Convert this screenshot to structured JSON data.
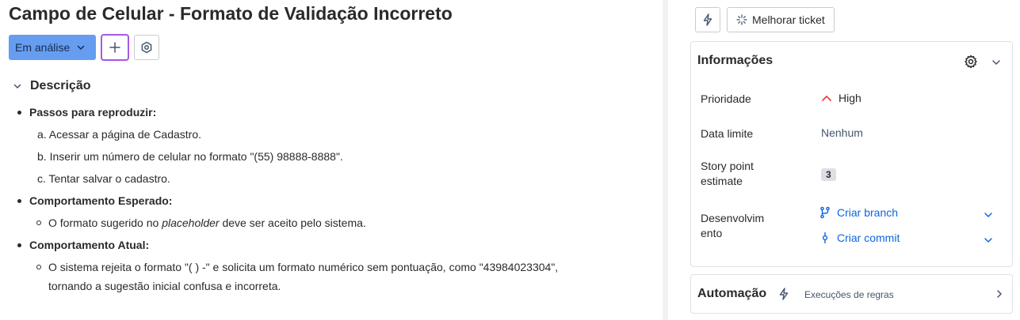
{
  "issue": {
    "title": "Campo de Celular - Formato de Validação Incorreto",
    "status_label": "Em análise"
  },
  "description": {
    "heading": "Descrição",
    "steps_heading": "Passos para reproduzir:",
    "steps": [
      "a. Acessar a página de Cadastro.",
      "b. Inserir um número de celular no formato \"(55) 98888-8888\".",
      "c. Tentar salvar o cadastro."
    ],
    "expected_heading": "Comportamento Esperado:",
    "expected_prefix": "O formato sugerido no ",
    "expected_italic": "placeholder",
    "expected_suffix": " deve ser aceito pelo sistema.",
    "actual_heading": "Comportamento Atual:",
    "actual_line1": "O sistema rejeita o formato \"( ) -\" e solicita um formato numérico sem pontuação, como \"43984023304\",",
    "actual_line2": "tornando a sugestão inicial confusa e incorreta."
  },
  "toolbar": {
    "improve_label": "Melhorar ticket"
  },
  "info": {
    "title": "Informações",
    "priority_label": "Prioridade",
    "priority_value": "High",
    "due_label": "Data limite",
    "due_value": "Nenhum",
    "story_label_1": "Story point",
    "story_label_2": "estimate",
    "story_value": "3",
    "dev_label_1": "Desenvolvim",
    "dev_label_2": "ento",
    "create_branch": "Criar branch",
    "create_commit": "Criar commit"
  },
  "automation": {
    "title": "Automação",
    "subtitle": "Execuções de regras"
  },
  "colors": {
    "status_bg": "#669df1",
    "add_border": "#a857e0",
    "link": "#0c66e4",
    "priority_high": "#e2483d"
  },
  "icons": [
    "chevron-down-icon",
    "plus-icon",
    "settings-icon",
    "bolt-icon",
    "sparkle-icon",
    "gear-icon",
    "branch-icon",
    "commit-icon",
    "chevron-right-icon",
    "priority-high-icon"
  ]
}
